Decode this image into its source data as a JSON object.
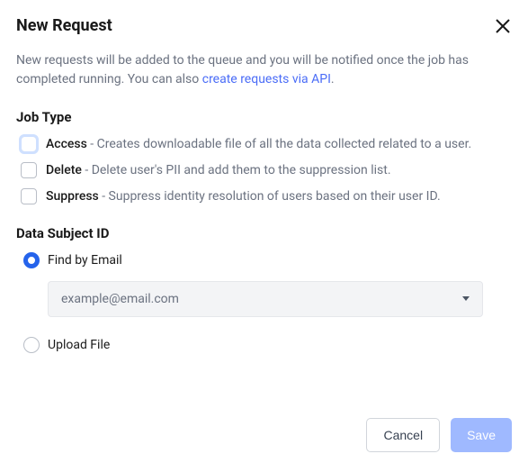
{
  "modal": {
    "title": "New Request",
    "description_prefix": "New requests will be added to the queue and you will be notified once the job has completed running. You can also ",
    "api_link": "create requests via API",
    "description_suffix": "."
  },
  "jobType": {
    "title": "Job Type",
    "options": [
      {
        "name": "Access",
        "desc": " - Creates downloadable file of all the data collected related to a user."
      },
      {
        "name": "Delete",
        "desc": " - Delete user's PII and add them to the suppression list."
      },
      {
        "name": "Suppress",
        "desc": " - Suppress identity resolution of users based on their user ID."
      }
    ]
  },
  "dataSubject": {
    "title": "Data Subject ID",
    "findByEmail": "Find by Email",
    "emailPlaceholder": "example@email.com",
    "uploadFile": "Upload File"
  },
  "actions": {
    "cancel": "Cancel",
    "save": "Save"
  }
}
